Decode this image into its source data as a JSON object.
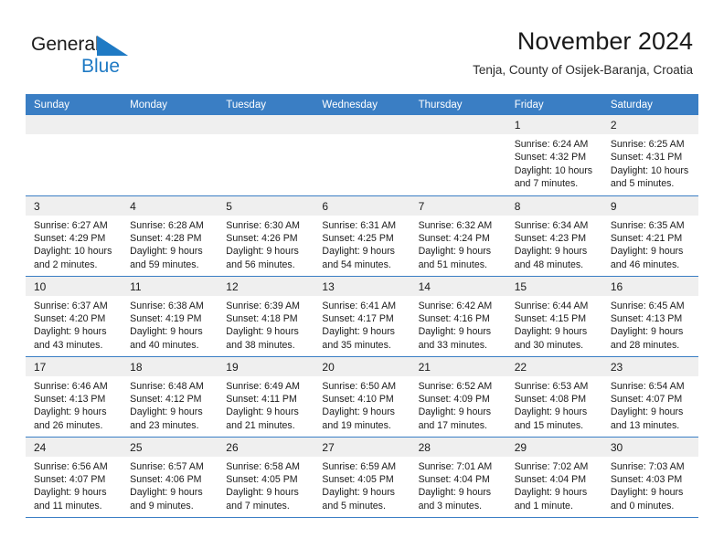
{
  "brand": {
    "name_primary": "General",
    "name_secondary": "Blue",
    "triangle_icon": "triangle-icon",
    "accent_color": "#1f7ac4"
  },
  "header": {
    "title": "November 2024",
    "subtitle": "Tenja, County of Osijek-Baranja, Croatia"
  },
  "calendar": {
    "header_bg": "#3a7ec4",
    "daynum_bg": "#efefef",
    "weekday_headers": [
      "Sunday",
      "Monday",
      "Tuesday",
      "Wednesday",
      "Thursday",
      "Friday",
      "Saturday"
    ],
    "weeks": [
      [
        {
          "day": "",
          "sunrise": "",
          "sunset": "",
          "daylight_1": "",
          "daylight_2": ""
        },
        {
          "day": "",
          "sunrise": "",
          "sunset": "",
          "daylight_1": "",
          "daylight_2": ""
        },
        {
          "day": "",
          "sunrise": "",
          "sunset": "",
          "daylight_1": "",
          "daylight_2": ""
        },
        {
          "day": "",
          "sunrise": "",
          "sunset": "",
          "daylight_1": "",
          "daylight_2": ""
        },
        {
          "day": "",
          "sunrise": "",
          "sunset": "",
          "daylight_1": "",
          "daylight_2": ""
        },
        {
          "day": "1",
          "sunrise": "Sunrise: 6:24 AM",
          "sunset": "Sunset: 4:32 PM",
          "daylight_1": "Daylight: 10 hours",
          "daylight_2": "and 7 minutes."
        },
        {
          "day": "2",
          "sunrise": "Sunrise: 6:25 AM",
          "sunset": "Sunset: 4:31 PM",
          "daylight_1": "Daylight: 10 hours",
          "daylight_2": "and 5 minutes."
        }
      ],
      [
        {
          "day": "3",
          "sunrise": "Sunrise: 6:27 AM",
          "sunset": "Sunset: 4:29 PM",
          "daylight_1": "Daylight: 10 hours",
          "daylight_2": "and 2 minutes."
        },
        {
          "day": "4",
          "sunrise": "Sunrise: 6:28 AM",
          "sunset": "Sunset: 4:28 PM",
          "daylight_1": "Daylight: 9 hours",
          "daylight_2": "and 59 minutes."
        },
        {
          "day": "5",
          "sunrise": "Sunrise: 6:30 AM",
          "sunset": "Sunset: 4:26 PM",
          "daylight_1": "Daylight: 9 hours",
          "daylight_2": "and 56 minutes."
        },
        {
          "day": "6",
          "sunrise": "Sunrise: 6:31 AM",
          "sunset": "Sunset: 4:25 PM",
          "daylight_1": "Daylight: 9 hours",
          "daylight_2": "and 54 minutes."
        },
        {
          "day": "7",
          "sunrise": "Sunrise: 6:32 AM",
          "sunset": "Sunset: 4:24 PM",
          "daylight_1": "Daylight: 9 hours",
          "daylight_2": "and 51 minutes."
        },
        {
          "day": "8",
          "sunrise": "Sunrise: 6:34 AM",
          "sunset": "Sunset: 4:23 PM",
          "daylight_1": "Daylight: 9 hours",
          "daylight_2": "and 48 minutes."
        },
        {
          "day": "9",
          "sunrise": "Sunrise: 6:35 AM",
          "sunset": "Sunset: 4:21 PM",
          "daylight_1": "Daylight: 9 hours",
          "daylight_2": "and 46 minutes."
        }
      ],
      [
        {
          "day": "10",
          "sunrise": "Sunrise: 6:37 AM",
          "sunset": "Sunset: 4:20 PM",
          "daylight_1": "Daylight: 9 hours",
          "daylight_2": "and 43 minutes."
        },
        {
          "day": "11",
          "sunrise": "Sunrise: 6:38 AM",
          "sunset": "Sunset: 4:19 PM",
          "daylight_1": "Daylight: 9 hours",
          "daylight_2": "and 40 minutes."
        },
        {
          "day": "12",
          "sunrise": "Sunrise: 6:39 AM",
          "sunset": "Sunset: 4:18 PM",
          "daylight_1": "Daylight: 9 hours",
          "daylight_2": "and 38 minutes."
        },
        {
          "day": "13",
          "sunrise": "Sunrise: 6:41 AM",
          "sunset": "Sunset: 4:17 PM",
          "daylight_1": "Daylight: 9 hours",
          "daylight_2": "and 35 minutes."
        },
        {
          "day": "14",
          "sunrise": "Sunrise: 6:42 AM",
          "sunset": "Sunset: 4:16 PM",
          "daylight_1": "Daylight: 9 hours",
          "daylight_2": "and 33 minutes."
        },
        {
          "day": "15",
          "sunrise": "Sunrise: 6:44 AM",
          "sunset": "Sunset: 4:15 PM",
          "daylight_1": "Daylight: 9 hours",
          "daylight_2": "and 30 minutes."
        },
        {
          "day": "16",
          "sunrise": "Sunrise: 6:45 AM",
          "sunset": "Sunset: 4:13 PM",
          "daylight_1": "Daylight: 9 hours",
          "daylight_2": "and 28 minutes."
        }
      ],
      [
        {
          "day": "17",
          "sunrise": "Sunrise: 6:46 AM",
          "sunset": "Sunset: 4:13 PM",
          "daylight_1": "Daylight: 9 hours",
          "daylight_2": "and 26 minutes."
        },
        {
          "day": "18",
          "sunrise": "Sunrise: 6:48 AM",
          "sunset": "Sunset: 4:12 PM",
          "daylight_1": "Daylight: 9 hours",
          "daylight_2": "and 23 minutes."
        },
        {
          "day": "19",
          "sunrise": "Sunrise: 6:49 AM",
          "sunset": "Sunset: 4:11 PM",
          "daylight_1": "Daylight: 9 hours",
          "daylight_2": "and 21 minutes."
        },
        {
          "day": "20",
          "sunrise": "Sunrise: 6:50 AM",
          "sunset": "Sunset: 4:10 PM",
          "daylight_1": "Daylight: 9 hours",
          "daylight_2": "and 19 minutes."
        },
        {
          "day": "21",
          "sunrise": "Sunrise: 6:52 AM",
          "sunset": "Sunset: 4:09 PM",
          "daylight_1": "Daylight: 9 hours",
          "daylight_2": "and 17 minutes."
        },
        {
          "day": "22",
          "sunrise": "Sunrise: 6:53 AM",
          "sunset": "Sunset: 4:08 PM",
          "daylight_1": "Daylight: 9 hours",
          "daylight_2": "and 15 minutes."
        },
        {
          "day": "23",
          "sunrise": "Sunrise: 6:54 AM",
          "sunset": "Sunset: 4:07 PM",
          "daylight_1": "Daylight: 9 hours",
          "daylight_2": "and 13 minutes."
        }
      ],
      [
        {
          "day": "24",
          "sunrise": "Sunrise: 6:56 AM",
          "sunset": "Sunset: 4:07 PM",
          "daylight_1": "Daylight: 9 hours",
          "daylight_2": "and 11 minutes."
        },
        {
          "day": "25",
          "sunrise": "Sunrise: 6:57 AM",
          "sunset": "Sunset: 4:06 PM",
          "daylight_1": "Daylight: 9 hours",
          "daylight_2": "and 9 minutes."
        },
        {
          "day": "26",
          "sunrise": "Sunrise: 6:58 AM",
          "sunset": "Sunset: 4:05 PM",
          "daylight_1": "Daylight: 9 hours",
          "daylight_2": "and 7 minutes."
        },
        {
          "day": "27",
          "sunrise": "Sunrise: 6:59 AM",
          "sunset": "Sunset: 4:05 PM",
          "daylight_1": "Daylight: 9 hours",
          "daylight_2": "and 5 minutes."
        },
        {
          "day": "28",
          "sunrise": "Sunrise: 7:01 AM",
          "sunset": "Sunset: 4:04 PM",
          "daylight_1": "Daylight: 9 hours",
          "daylight_2": "and 3 minutes."
        },
        {
          "day": "29",
          "sunrise": "Sunrise: 7:02 AM",
          "sunset": "Sunset: 4:04 PM",
          "daylight_1": "Daylight: 9 hours",
          "daylight_2": "and 1 minute."
        },
        {
          "day": "30",
          "sunrise": "Sunrise: 7:03 AM",
          "sunset": "Sunset: 4:03 PM",
          "daylight_1": "Daylight: 9 hours",
          "daylight_2": "and 0 minutes."
        }
      ]
    ]
  }
}
